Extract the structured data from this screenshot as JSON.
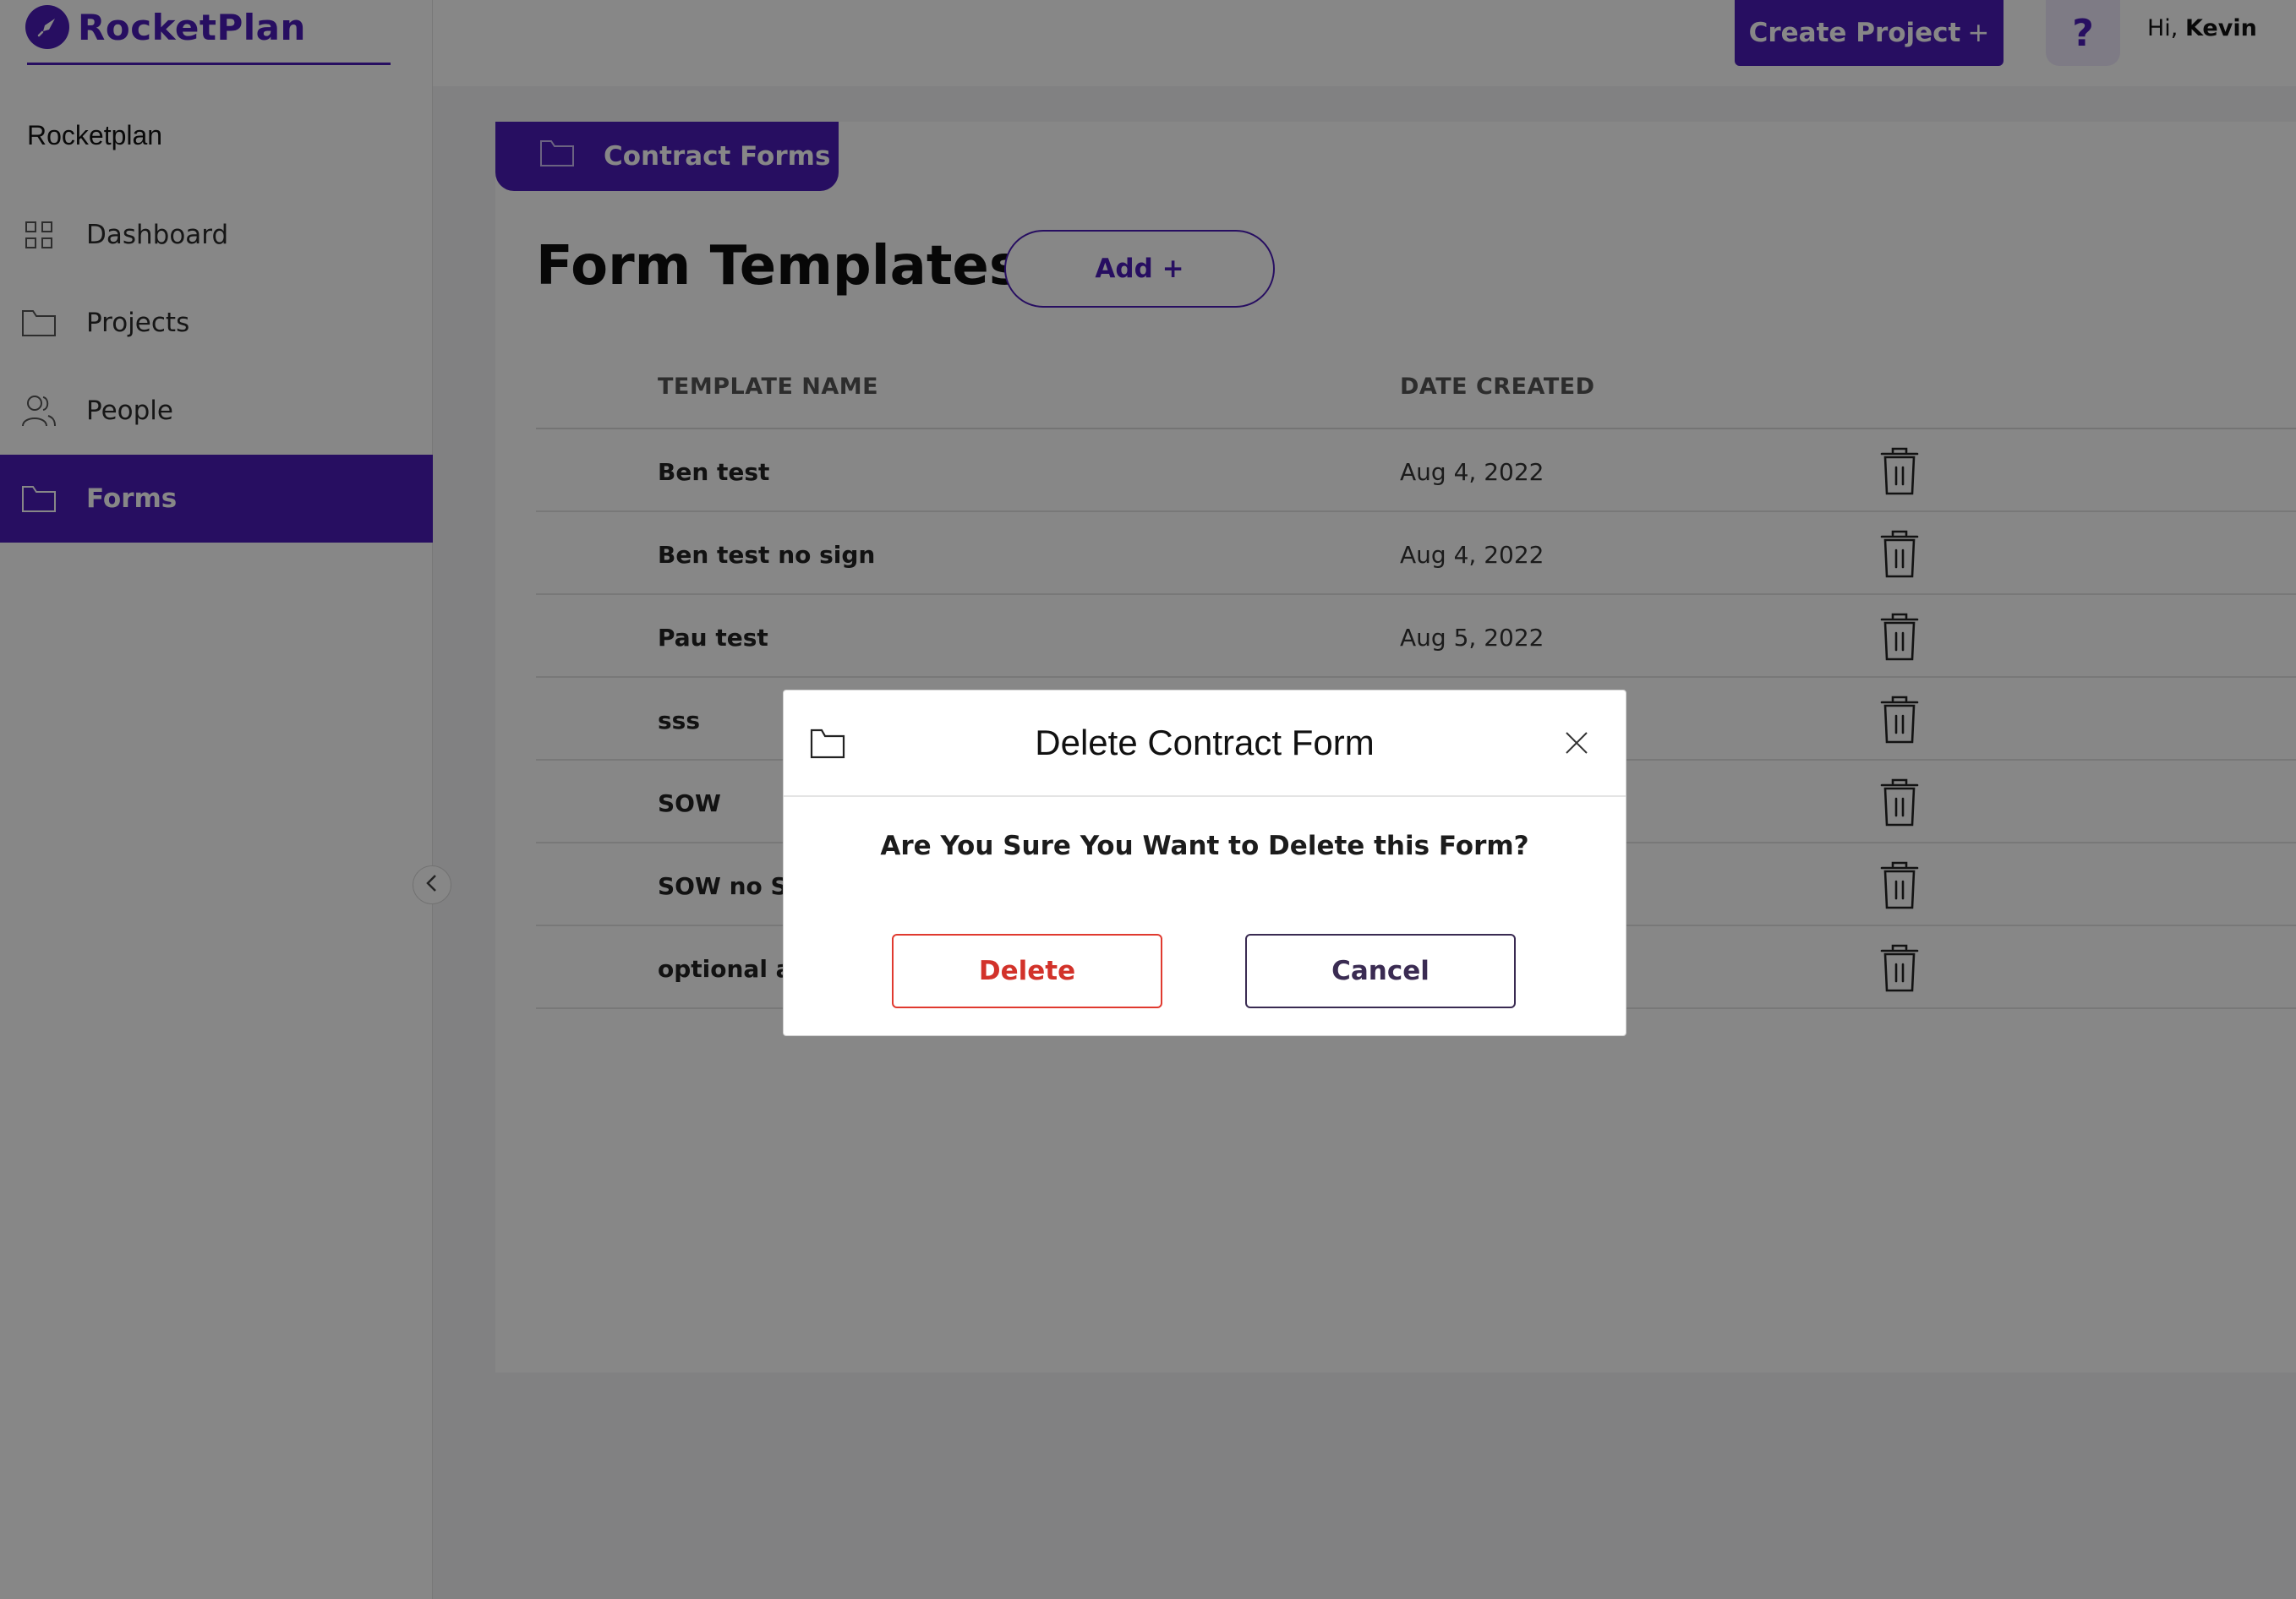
{
  "brand": {
    "name": "RocketPlan",
    "accent": "#4a1cb8"
  },
  "sidebar": {
    "org_name": "Rocketplan",
    "items": [
      {
        "label": "Dashboard",
        "icon": "grid-icon",
        "active": false
      },
      {
        "label": "Projects",
        "icon": "folder-icon",
        "active": false
      },
      {
        "label": "People",
        "icon": "people-icon",
        "active": false
      },
      {
        "label": "Forms",
        "icon": "folder-icon",
        "active": true
      }
    ],
    "collapse_icon": "chevron-left-icon"
  },
  "topbar": {
    "create_label": "Create Project",
    "create_plus": "+",
    "help_label": "?",
    "greeting_prefix": "Hi,",
    "user_name": "Kevin"
  },
  "main": {
    "tab_label": "Contract Forms",
    "title": "Form Templates",
    "add_label": "Add +",
    "columns": {
      "name": "TEMPLATE NAME",
      "date": "DATE CREATED"
    },
    "rows": [
      {
        "name": "Ben test",
        "date": "Aug 4, 2022"
      },
      {
        "name": "Ben test no sign",
        "date": "Aug 4, 2022"
      },
      {
        "name": "Pau test",
        "date": "Aug 5, 2022"
      },
      {
        "name": "sss",
        "date": ""
      },
      {
        "name": "SOW",
        "date": ""
      },
      {
        "name": "SOW no Sig",
        "date": ""
      },
      {
        "name": "optional and",
        "date": ""
      }
    ]
  },
  "modal": {
    "title": "Delete Contract Form",
    "question": "Are You Sure You Want to Delete this Form?",
    "delete_label": "Delete",
    "cancel_label": "Cancel",
    "delete_color": "#d2322a"
  }
}
